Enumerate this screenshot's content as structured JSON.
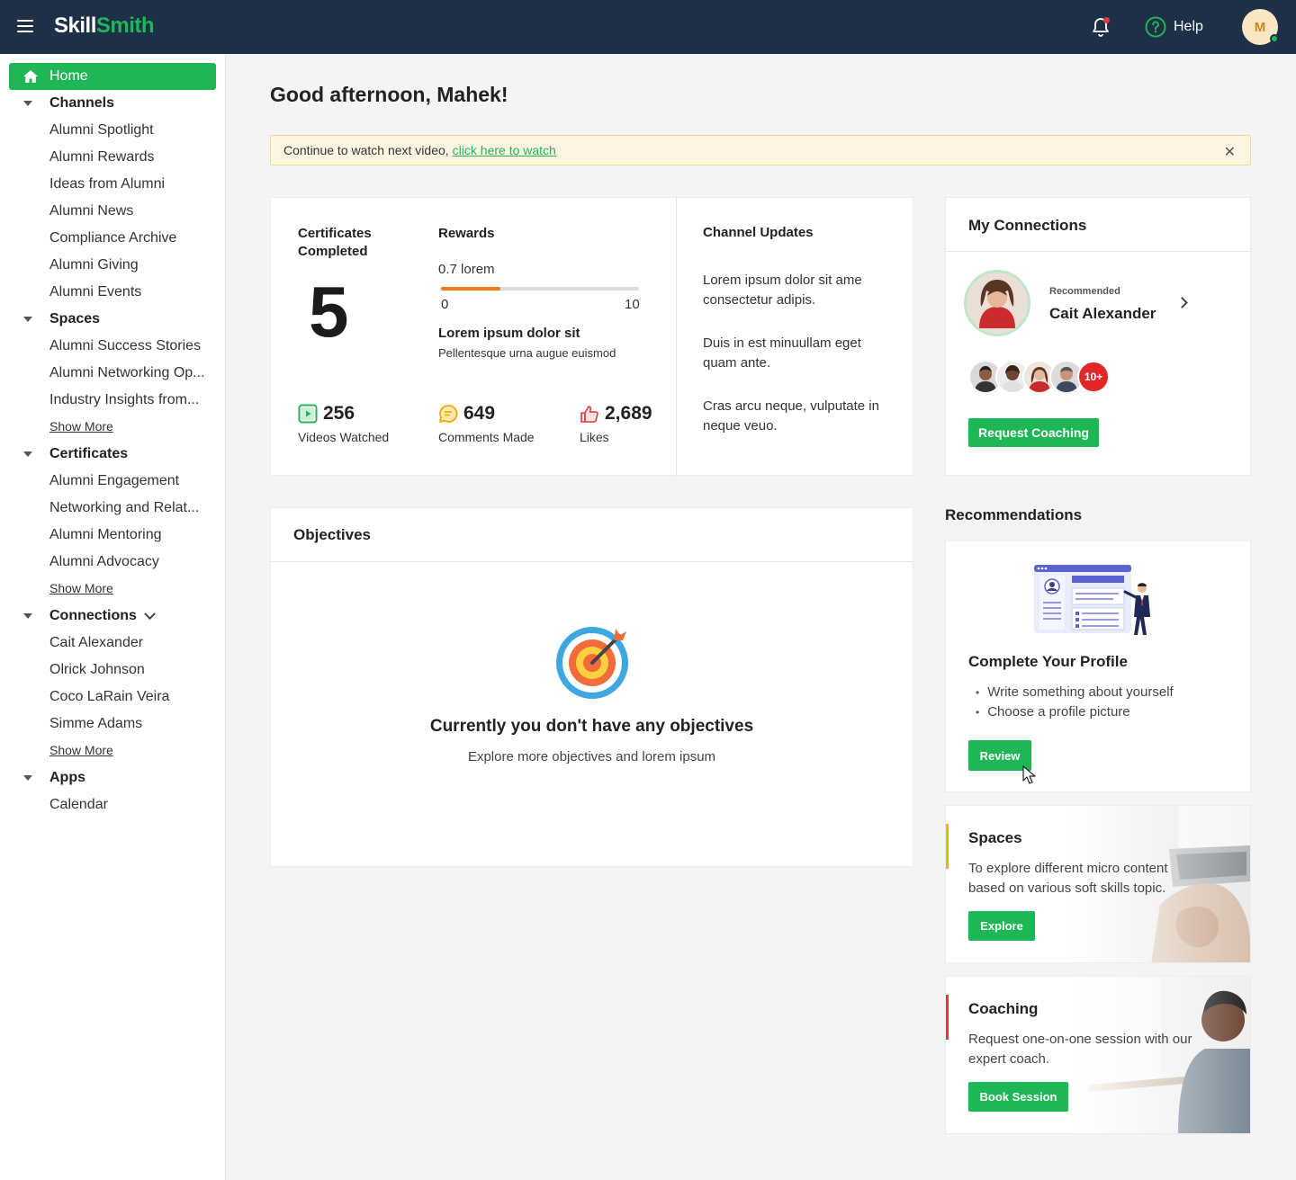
{
  "app": {
    "logo_part1": "Skill",
    "logo_part2": "Smith",
    "help_label": "Help",
    "avatar_initial": "M"
  },
  "colors": {
    "accent": "#1fb656",
    "header": "#1e3048",
    "progress": "#f47b20",
    "badge": "#e12727",
    "spaces_accent": "#f5b400",
    "coaching_accent": "#e23a3a"
  },
  "sidebar": {
    "home": "Home",
    "sections": {
      "channels": {
        "label": "Channels",
        "items": [
          "Alumni Spotlight",
          "Alumni Rewards",
          "Ideas from Alumni",
          "Alumni News",
          "Compliance Archive",
          "Alumni Giving",
          "Alumni Events"
        ]
      },
      "spaces": {
        "label": "Spaces",
        "items": [
          "Alumni Success Stories",
          "Alumni Networking Op...",
          "Industry Insights from..."
        ],
        "show_more": "Show More"
      },
      "certificates": {
        "label": "Certificates",
        "items": [
          "Alumni Engagement",
          "Networking and Relat...",
          "Alumni Mentoring",
          "Alumni Advocacy"
        ],
        "show_more": "Show More"
      },
      "connections": {
        "label": "Connections",
        "items": [
          "Cait Alexander",
          "Olrick Johnson",
          "Coco LaRain Veira",
          "Simme Adams"
        ],
        "show_more": "Show More"
      },
      "apps": {
        "label": "Apps",
        "items": [
          "Calendar"
        ]
      }
    }
  },
  "main": {
    "greeting": "Good afternoon, Mahek!",
    "banner": {
      "text": "Continue to watch next video,",
      "link": "click here to watch",
      "close": "✕"
    },
    "stats": {
      "certificates_label_1": "Certificates",
      "certificates_label_2": "Completed",
      "certificates_value": "5",
      "rewards_label": "Rewards",
      "rewards_sub": "0.7 lorem",
      "rewards_progress": 0.3,
      "rewards_min": "0",
      "rewards_max": "10",
      "rewards_title": "Lorem ipsum dolor sit",
      "rewards_desc": "Pellentesque urna augue euismod",
      "videos_value": "256",
      "videos_label": "Videos Watched",
      "comments_value": "649",
      "comments_label": "Comments Made",
      "likes_value": "2,689",
      "likes_label": "Likes"
    },
    "channel_updates": {
      "title": "Channel Updates",
      "items": [
        "Lorem ipsum dolor sit ame consectetur adipis.",
        "Duis in est minuullam eget quam ante.",
        "Cras arcu neque, vulputate in neque veuo."
      ]
    },
    "objectives": {
      "title": "Objectives",
      "empty_title": "Currently you don't have any objectives",
      "empty_sub": "Explore more objectives and lorem ipsum"
    }
  },
  "right": {
    "connections": {
      "title": "My Connections",
      "recommended_label": "Recommended",
      "recommended_name": "Cait Alexander",
      "more_badge": "10+",
      "button": "Request Coaching"
    },
    "recommendations_title": "Recommendations",
    "profile": {
      "title": "Complete Your Profile",
      "items": [
        "Write something about yourself",
        "Choose a profile picture"
      ],
      "button": "Review"
    },
    "spaces": {
      "title": "Spaces",
      "desc": "To explore different micro content based on various soft skills topic.",
      "button": "Explore"
    },
    "coaching": {
      "title": "Coaching",
      "desc": "Request one-on-one session with our expert coach.",
      "button": "Book Session"
    }
  }
}
